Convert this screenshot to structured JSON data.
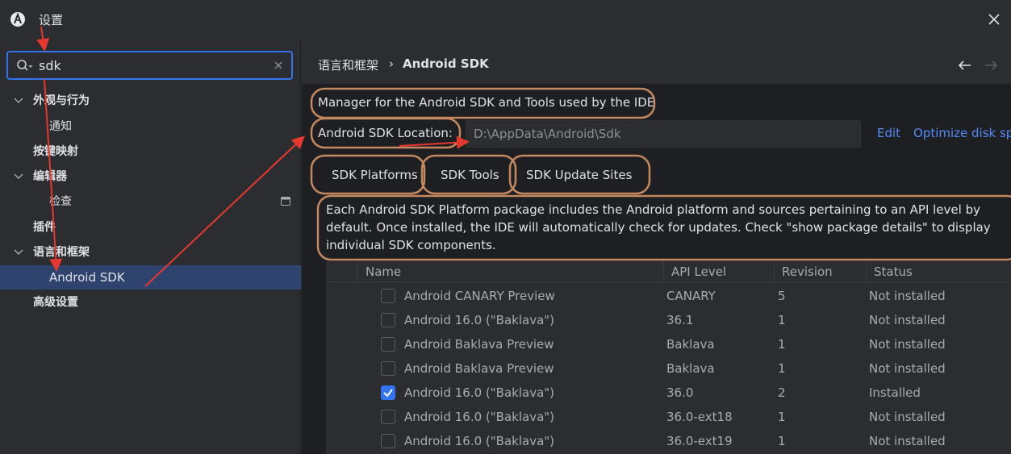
{
  "window": {
    "title": "设置",
    "app_icon": "android-studio-icon",
    "close_icon": "close-icon"
  },
  "sidebar": {
    "search": {
      "value": "sdk",
      "icon": "search-icon",
      "clear_icon": "clear-icon"
    },
    "items": [
      {
        "label": "外观与行为",
        "level": 0,
        "expanded": true
      },
      {
        "label": "通知",
        "level": 1
      },
      {
        "label": "按键映射",
        "level": 0
      },
      {
        "label": "编辑器",
        "level": 0,
        "expanded": true
      },
      {
        "label": "检查",
        "level": 1
      },
      {
        "label": "插件",
        "level": 0
      },
      {
        "label": "语言和框架",
        "level": 0,
        "expanded": true
      },
      {
        "label": "Android SDK",
        "level": 1,
        "selected": true
      },
      {
        "label": "高级设置",
        "level": 0
      }
    ]
  },
  "breadcrumb": {
    "parent": "语言和框架",
    "separator": "›",
    "current": "Android SDK"
  },
  "main": {
    "description": "Manager for the Android SDK and Tools used by the IDE",
    "location_label": "Android SDK Location:",
    "location_value": "D:\\AppData\\Android\\Sdk",
    "edit_link": "Edit",
    "optimize_link": "Optimize disk sp",
    "tabs": [
      "SDK Platforms",
      "SDK Tools",
      "SDK Update Sites"
    ],
    "info": "Each Android SDK Platform package includes the Android platform and sources pertaining to an API level by default. Once installed, the IDE will automatically check for updates. Check \"show package details\" to display individual SDK components."
  },
  "table": {
    "columns": [
      "Name",
      "API Level",
      "Revision",
      "Status"
    ],
    "rows": [
      {
        "checked": false,
        "name": "Android CANARY Preview",
        "api": "CANARY",
        "revision": "5",
        "status": "Not installed"
      },
      {
        "checked": false,
        "name": "Android 16.0 (\"Baklava\")",
        "api": "36.1",
        "revision": "1",
        "status": "Not installed"
      },
      {
        "checked": false,
        "name": "Android Baklava Preview",
        "api": "Baklava",
        "revision": "1",
        "status": "Not installed"
      },
      {
        "checked": false,
        "name": "Android Baklava Preview",
        "api": "Baklava",
        "revision": "1",
        "status": "Not installed"
      },
      {
        "checked": true,
        "name": "Android 16.0 (\"Baklava\")",
        "api": "36.0",
        "revision": "2",
        "status": "Installed"
      },
      {
        "checked": false,
        "name": "Android 16.0 (\"Baklava\")",
        "api": "36.0-ext18",
        "revision": "1",
        "status": "Not installed"
      },
      {
        "checked": false,
        "name": "Android 16.0 (\"Baklava\")",
        "api": "36.0-ext19",
        "revision": "1",
        "status": "Not installed"
      }
    ]
  },
  "colors": {
    "accent": "#3574f0",
    "link": "#548af7",
    "annotation_box": "#c4875e",
    "annotation_arrow": "#e8372f",
    "selection": "#2e436e"
  }
}
